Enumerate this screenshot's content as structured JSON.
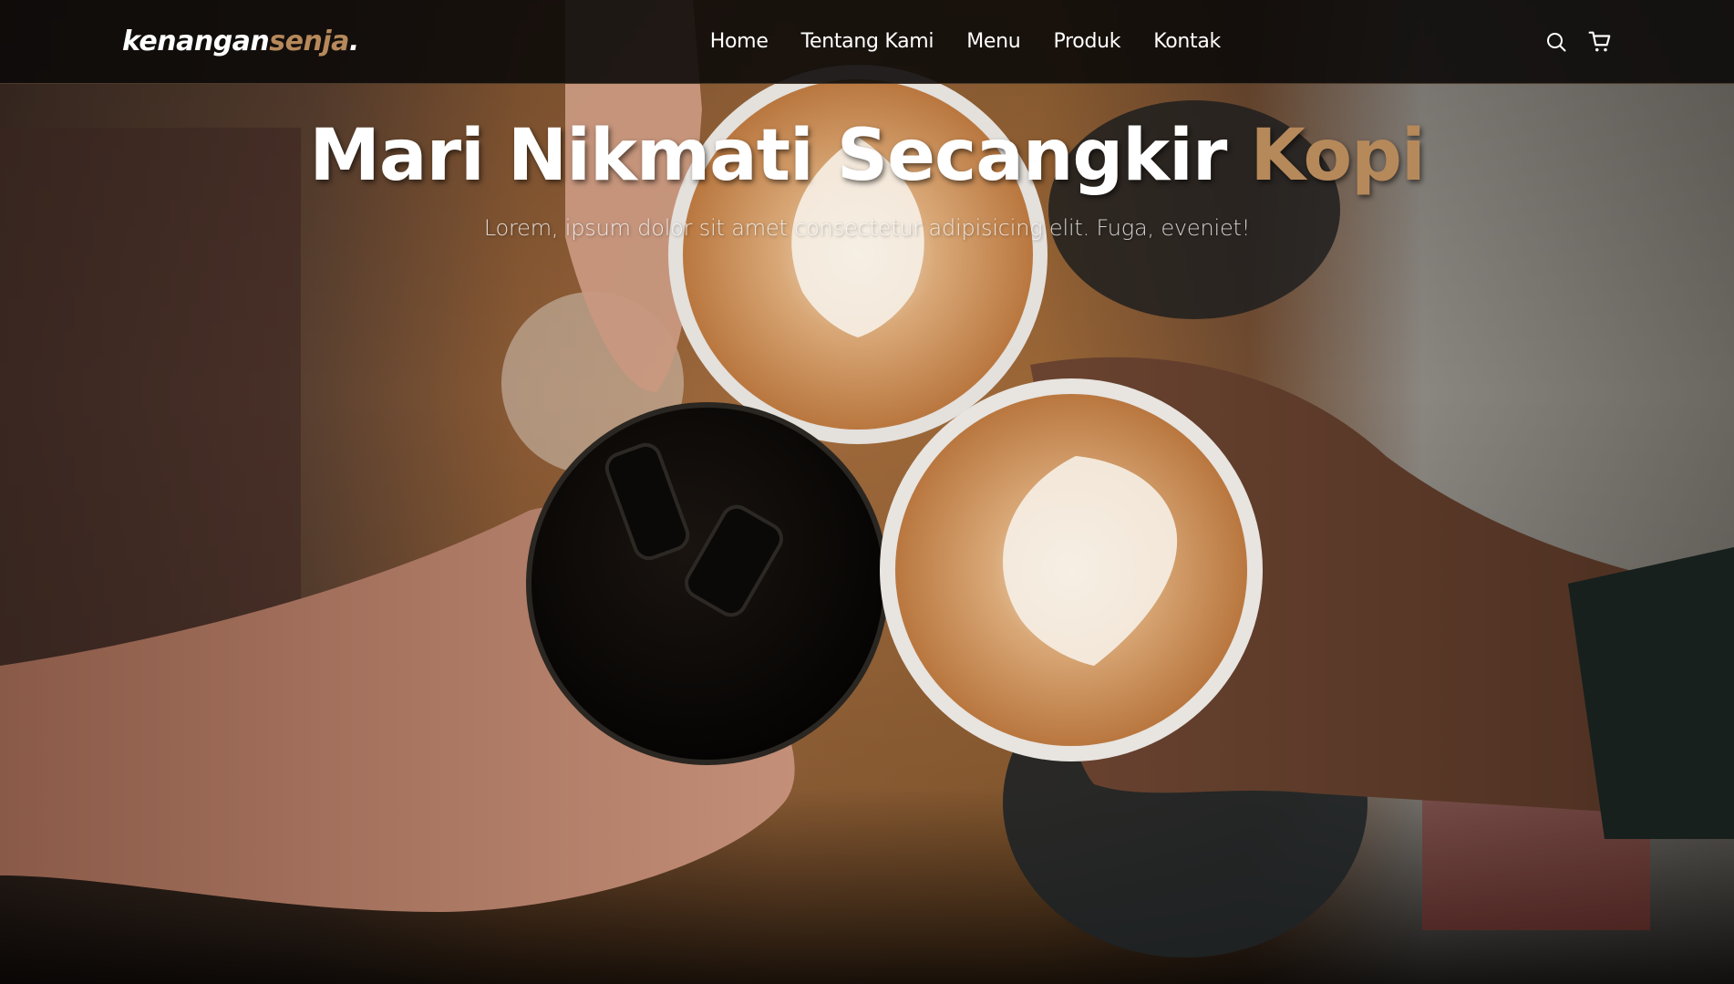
{
  "brand": {
    "name_main": "kenangan",
    "name_accent": "senja",
    "name_dot": "."
  },
  "nav": {
    "items": [
      {
        "label": "Home"
      },
      {
        "label": "Tentang Kami"
      },
      {
        "label": "Menu"
      },
      {
        "label": "Produk"
      },
      {
        "label": "Kontak"
      }
    ],
    "icons": [
      "search-icon",
      "shopping-cart-icon"
    ]
  },
  "hero": {
    "title_main": "Mari Nikmati Secangkir ",
    "title_accent": "Kopi",
    "subtitle": "Lorem, ipsum dolor sit amet consectetur adipisicing elit. Fuga, eveniet!",
    "background": "coffee-cups-toast-photo"
  },
  "colors": {
    "accent": "#b6895b",
    "navbar_bg": "#0c0a09",
    "text": "#ffffff"
  }
}
